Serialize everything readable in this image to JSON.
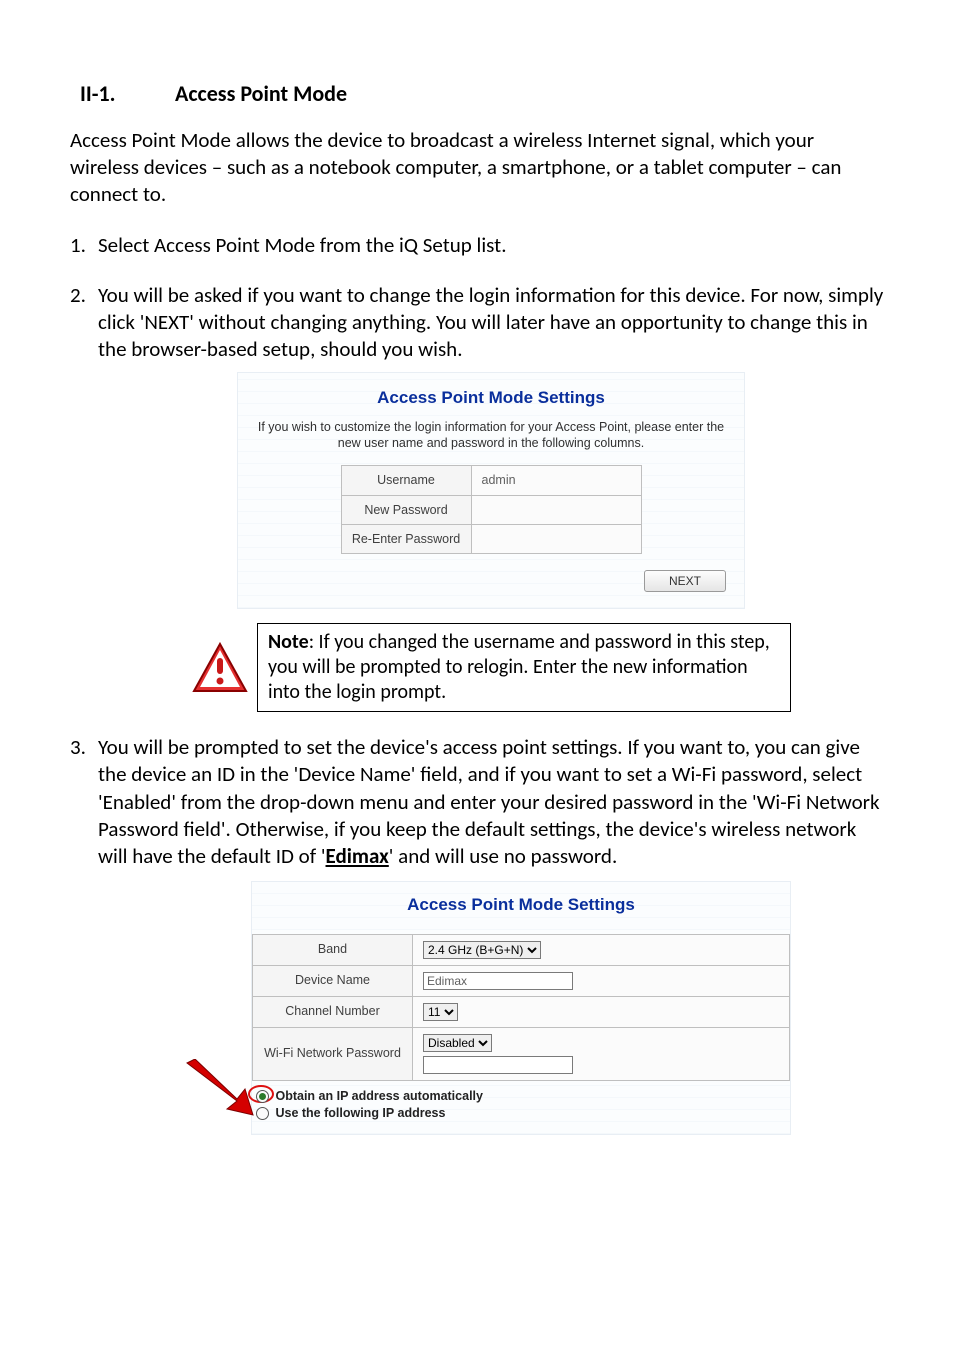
{
  "heading": {
    "number": "II-1.",
    "title": "Access Point Mode"
  },
  "intro": "Access Point Mode allows the device to broadcast a wireless Internet signal, which your wireless devices – such as a notebook computer, a smartphone, or a tablet computer – can connect to.",
  "steps": {
    "s1": "Select Access Point Mode from the iQ Setup list.",
    "s2": "You will be asked if you want to change the login information for this device. For now, simply click 'NEXT' without changing anything. You will later have an opportunity to change this in the browser-based setup, should you wish.",
    "s3_a": "You will be prompted to set the device's access point settings. If you want to, you can give the device an ID in the 'Device Name' field, and if you want to set a Wi-Fi password, select 'Enabled' from the drop-down menu and enter your desired password in the 'Wi-Fi Network Password field'. Otherwise, if you keep the default settings, the device's wireless network will have the default ID of '",
    "s3_edimax": "Edimax",
    "s3_b": "' and will use no password."
  },
  "panel1": {
    "title": "Access Point Mode Settings",
    "desc": "If you wish to customize the login information for your Access Point, please enter the new user name and password in the following columns.",
    "rows": {
      "username_lbl": "Username",
      "username_val": "admin",
      "newpw_lbl": "New Password",
      "newpw_val": "",
      "repw_lbl": "Re-Enter Password",
      "repw_val": ""
    },
    "next": "NEXT"
  },
  "note": {
    "label": "Note",
    "text": ": If you changed the username and password in this step, you will be prompted to relogin. Enter the new information into the login prompt."
  },
  "panel2": {
    "title": "Access Point Mode Settings",
    "rows": {
      "band_lbl": "Band",
      "band_val": "2.4 GHz (B+G+N)",
      "devname_lbl": "Device Name",
      "devname_val": "Edimax",
      "chan_lbl": "Channel Number",
      "chan_val": "11",
      "wifipw_lbl": "Wi-Fi Network Password",
      "wifipw_sel": "Disabled",
      "wifipw_val": ""
    },
    "radios": {
      "auto": "Obtain an IP address automatically",
      "manual": "Use the following IP address"
    }
  }
}
